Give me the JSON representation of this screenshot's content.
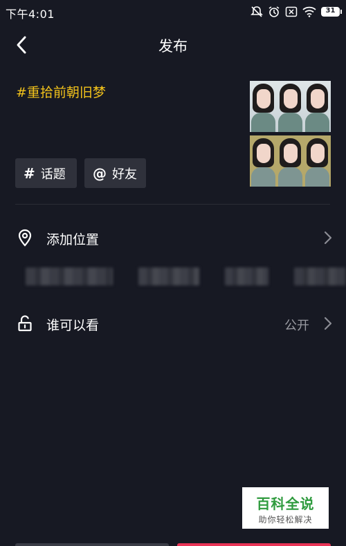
{
  "status_bar": {
    "time": "下午4:01",
    "battery": {
      "label": "31",
      "level": 0.31
    },
    "icons": [
      "mute-icon",
      "alarm-icon",
      "sim-icon",
      "wifi-icon",
      "battery-icon"
    ]
  },
  "nav": {
    "title": "发布",
    "back_icon": "chevron-left-icon"
  },
  "post": {
    "caption": "#重拾前朝旧梦"
  },
  "chips": {
    "topic": {
      "icon": "#",
      "label": "话题"
    },
    "friend": {
      "icon": "@",
      "label": "好友"
    }
  },
  "location": {
    "label": "添加位置",
    "icon": "location-pin-icon"
  },
  "privacy": {
    "label": "谁可以看",
    "value": "公开",
    "icon": "unlock-icon"
  },
  "watermark": {
    "title": "百科全说",
    "subtitle": "助你轻松解决"
  },
  "colors": {
    "background": "#171923",
    "caption": "#f2c21b",
    "chip": "#2f313b",
    "publish": "#e93456",
    "watermark_brand": "#2f9b3e"
  }
}
